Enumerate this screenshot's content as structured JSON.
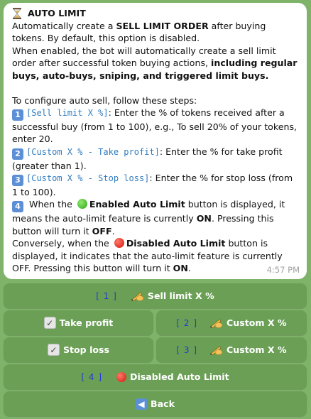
{
  "message": {
    "title": "AUTO LIMIT",
    "intro_1": "Automatically create a ",
    "intro_bold": "SELL LIMIT ORDER",
    "intro_2": " after buying tokens. By default, this option is disabled.",
    "when_1": "When enabled, the bot will automatically create a sell limit order after successful token buying actions, ",
    "when_bold": "including regular buys, auto-buys, sniping, and triggered limit buys.",
    "steps_intro": "To configure auto sell, follow these steps:",
    "step1_num": "1",
    "step1_code": "[Sell limit X %]",
    "step1_text": ": Enter the % of tokens received after a successful buy (from 1 to 100), e.g., To sell 20% of your tokens, enter 20.",
    "step2_num": "2",
    "step2_code": "[Custom X % - Take profit]",
    "step2_text": ": Enter the % for take profit (greater than 1).",
    "step3_num": "3",
    "step3_code": "[Custom X % - Stop loss]",
    "step3_text": ": Enter the % for stop loss (from 1 to 100).",
    "step4_num": "4",
    "step4_a": " When the ",
    "step4_bold": "Enabled Auto Limit",
    "step4_b": " button is displayed, it means the auto-limit feature is currently ",
    "step4_on": "ON",
    "step4_c": ". Pressing this button will turn it ",
    "step4_off": "OFF",
    "step4_d": ".",
    "conv_a": "Conversely, when the ",
    "conv_bold": "Disabled Auto Limit",
    "conv_b": " button is displayed, it indicates that the auto-limit feature is currently OFF. Pressing this button will turn it ",
    "conv_on": "ON",
    "conv_c": ".",
    "time": "4:57 PM"
  },
  "keyboard": {
    "sell_limit": {
      "tag": "[ 1 ]",
      "label": "Sell limit X %"
    },
    "take_profit": {
      "label": "Take profit"
    },
    "custom_tp": {
      "tag": "[ 2 ]",
      "label": "Custom X %"
    },
    "stop_loss": {
      "label": "Stop loss"
    },
    "custom_sl": {
      "tag": "[ 3 ]",
      "label": "Custom X %"
    },
    "auto_limit": {
      "tag": "[ 4 ]",
      "label": "Disabled Auto Limit"
    },
    "back": {
      "label": "Back"
    }
  },
  "colors": {
    "background": "#7fb36a",
    "button": "#6a9f55",
    "tag": "#1f3cd6",
    "code": "#2f7cc0"
  }
}
